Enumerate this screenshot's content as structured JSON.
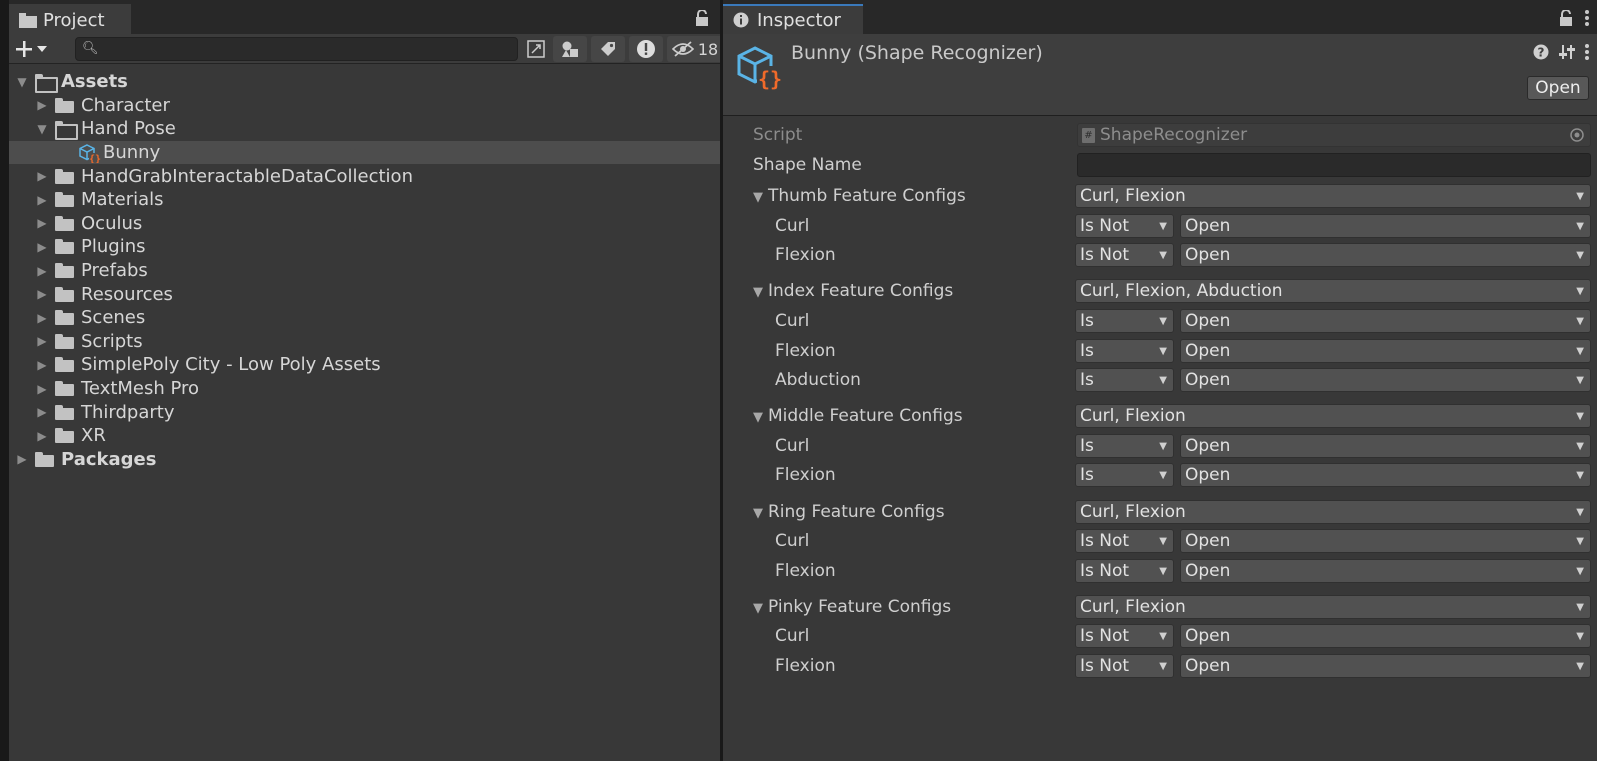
{
  "project_panel": {
    "tab_label": "Project",
    "hidden_count": "18",
    "search": {
      "value": "",
      "placeholder": ""
    },
    "tree": [
      {
        "label": "Assets",
        "depth": 0,
        "expanded": true,
        "bold": true,
        "kind": "folder"
      },
      {
        "label": "Character",
        "depth": 1,
        "expanded": false,
        "kind": "folder"
      },
      {
        "label": "Hand Pose",
        "depth": 1,
        "expanded": true,
        "kind": "folder"
      },
      {
        "label": "Bunny",
        "depth": 2,
        "kind": "asset",
        "selected": true
      },
      {
        "label": "HandGrabInteractableDataCollection",
        "depth": 1,
        "expanded": false,
        "kind": "folder"
      },
      {
        "label": "Materials",
        "depth": 1,
        "expanded": false,
        "kind": "folder"
      },
      {
        "label": "Oculus",
        "depth": 1,
        "expanded": false,
        "kind": "folder"
      },
      {
        "label": "Plugins",
        "depth": 1,
        "expanded": false,
        "kind": "folder"
      },
      {
        "label": "Prefabs",
        "depth": 1,
        "expanded": false,
        "kind": "folder"
      },
      {
        "label": "Resources",
        "depth": 1,
        "expanded": false,
        "kind": "folder"
      },
      {
        "label": "Scenes",
        "depth": 1,
        "expanded": false,
        "kind": "folder"
      },
      {
        "label": "Scripts",
        "depth": 1,
        "expanded": false,
        "kind": "folder"
      },
      {
        "label": "SimplePoly City - Low Poly Assets",
        "depth": 1,
        "expanded": false,
        "kind": "folder"
      },
      {
        "label": "TextMesh Pro",
        "depth": 1,
        "expanded": false,
        "kind": "folder"
      },
      {
        "label": "Thirdparty",
        "depth": 1,
        "expanded": false,
        "kind": "folder"
      },
      {
        "label": "XR",
        "depth": 1,
        "expanded": false,
        "kind": "folder"
      },
      {
        "label": "Packages",
        "depth": 0,
        "expanded": false,
        "bold": true,
        "kind": "folder"
      }
    ]
  },
  "inspector": {
    "tab_label": "Inspector",
    "title": "Bunny (Shape Recognizer)",
    "open_button": "Open",
    "script_label": "Script",
    "script_value": "ShapeRecognizer",
    "shape_name_label": "Shape Name",
    "shape_name_value": "",
    "groups": [
      {
        "label": "Thumb Feature Configs",
        "value": "Curl, Flexion",
        "items": [
          {
            "label": "Curl",
            "mode": "Is Not",
            "state": "Open"
          },
          {
            "label": "Flexion",
            "mode": "Is Not",
            "state": "Open"
          }
        ]
      },
      {
        "label": "Index Feature Configs",
        "value": "Curl, Flexion, Abduction",
        "items": [
          {
            "label": "Curl",
            "mode": "Is",
            "state": "Open"
          },
          {
            "label": "Flexion",
            "mode": "Is",
            "state": "Open"
          },
          {
            "label": "Abduction",
            "mode": "Is",
            "state": "Open"
          }
        ]
      },
      {
        "label": "Middle Feature Configs",
        "value": "Curl, Flexion",
        "items": [
          {
            "label": "Curl",
            "mode": "Is",
            "state": "Open"
          },
          {
            "label": "Flexion",
            "mode": "Is",
            "state": "Open"
          }
        ]
      },
      {
        "label": "Ring Feature Configs",
        "value": "Curl, Flexion",
        "items": [
          {
            "label": "Curl",
            "mode": "Is Not",
            "state": "Open"
          },
          {
            "label": "Flexion",
            "mode": "Is Not",
            "state": "Open"
          }
        ]
      },
      {
        "label": "Pinky Feature Configs",
        "value": "Curl, Flexion",
        "items": [
          {
            "label": "Curl",
            "mode": "Is Not",
            "state": "Open"
          },
          {
            "label": "Flexion",
            "mode": "Is Not",
            "state": "Open"
          }
        ]
      }
    ]
  },
  "colors": {
    "accent": "#3a79bb",
    "panel": "#383838",
    "field": "#515151",
    "icon_blue": "#5ab4e6",
    "icon_orange": "#f06a2a"
  }
}
